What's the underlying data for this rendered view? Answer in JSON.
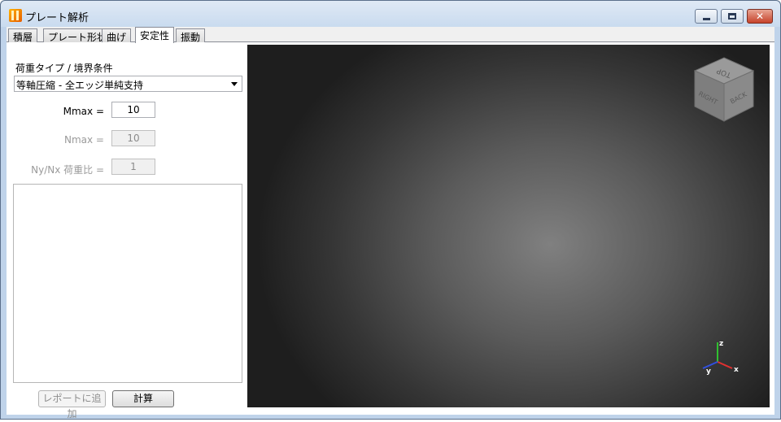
{
  "window": {
    "title": "プレート解析",
    "controls": {
      "minimize": "minimize",
      "maximize": "maximize",
      "close": "✕"
    }
  },
  "tabs": [
    {
      "label": "積層",
      "active": false
    },
    {
      "label": "プレート形状",
      "active": false
    },
    {
      "label": "曲げ",
      "active": false
    },
    {
      "label": "安定性",
      "active": true
    },
    {
      "label": "振動",
      "active": false
    }
  ],
  "stability": {
    "load_type_label": "荷重タイプ / 境界条件",
    "load_type_value": "等軸圧縮 - 全エッジ単純支持",
    "mmax_label": "Mmax =",
    "mmax_value": "10",
    "nmax_label": "Nmax =",
    "nmax_value": "10",
    "ratio_label": "Ny/Nx 荷重比 =",
    "ratio_value": "1",
    "add_report_label": "レポートに追加",
    "calculate_label": "計算"
  },
  "viewport": {
    "cube_faces": {
      "top": "TOP",
      "right": "RIGHT",
      "back": "BACK"
    },
    "axes": {
      "x": "x",
      "y": "y",
      "z": "z"
    },
    "colors": {
      "x_axis": "#e03030",
      "y_axis": "#3050e0",
      "z_axis": "#30c030"
    }
  }
}
